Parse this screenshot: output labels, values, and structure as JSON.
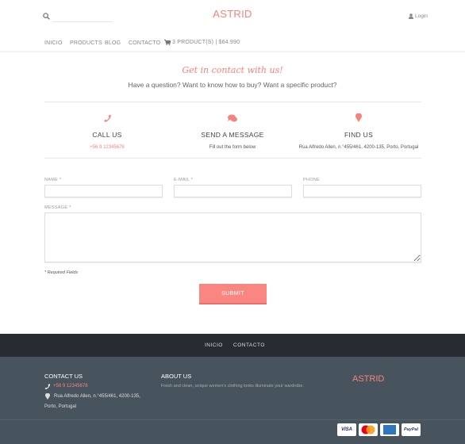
{
  "header": {
    "brand": "ASTRID",
    "search_placeholder": "",
    "login": "Login"
  },
  "nav": {
    "items": [
      "INICIO",
      "PRODUCTS",
      "BLOG",
      "CONTACTO"
    ],
    "cart": "3 PRODUCT(S) | $64.990"
  },
  "hero": {
    "title": "Get in contact with us!",
    "subtitle": "Have a question? Want to know how to buy? Want a specific product?"
  },
  "contact": [
    {
      "icon": "phone-icon",
      "title": "CALL US",
      "text": "+56 9 12345678"
    },
    {
      "icon": "comments-icon",
      "title": "SEND A MESSAGE",
      "text": "Fill out the form below"
    },
    {
      "icon": "map-marker-icon",
      "title": "FIND US",
      "text": "Rua Alfredo Allen, n.°455/461, 4200-135, Porto, Portugal"
    }
  ],
  "form": {
    "name_label": "NAME *",
    "email_label": "E-MAIL *",
    "phone_label": "PHONE",
    "message_label": "MESSAGE *",
    "name": "",
    "email": "",
    "phone": "",
    "message": "",
    "required_note": "* Required Fields",
    "submit": "SUBMIT"
  },
  "footer": {
    "nav": [
      "INICIO",
      "CONTACTO"
    ],
    "contact_title": "CONTACT US",
    "phone": "+56 9 12345678",
    "address": "Rua Alfredo Allen, n.°455/461, 4200-135, Porto, Portugal",
    "about_title": "ABOUT US",
    "about_text": "Fresh and clean, unique women's clothing looks illuminate your wardrobe.",
    "brand": "ASTRID",
    "payments": [
      "VISA",
      "Mastercard",
      "American Express",
      "PayPal"
    ]
  },
  "colors": {
    "accent": "#f7827a",
    "footer_dark": "#272c33",
    "footer": "#48545d"
  }
}
